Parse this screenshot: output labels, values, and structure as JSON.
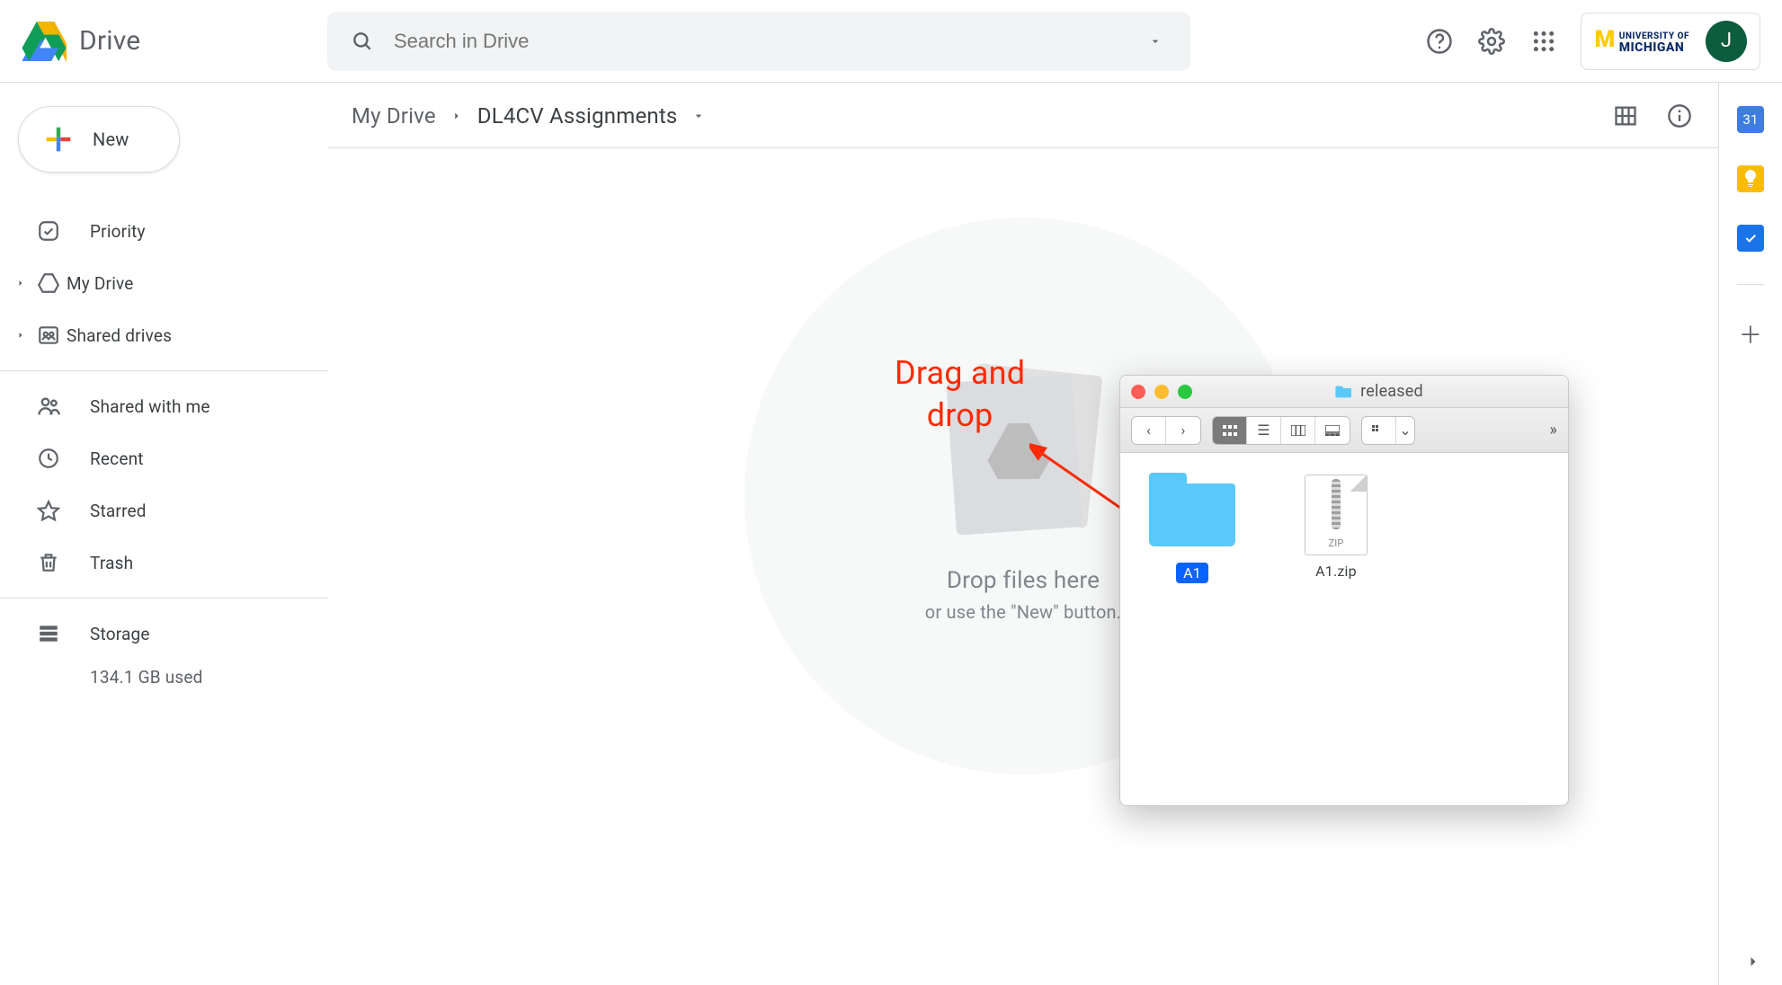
{
  "header": {
    "product_name": "Drive",
    "search_placeholder": "Search in Drive",
    "org_text_top": "UNIVERSITY OF",
    "org_text_bottom": "MICHIGAN",
    "avatar_initial": "J"
  },
  "sidebar": {
    "new_label": "New",
    "items": [
      {
        "label": "Priority",
        "icon": "priority-icon"
      },
      {
        "label": "My Drive",
        "icon": "my-drive-icon"
      },
      {
        "label": "Shared drives",
        "icon": "shared-drives-icon"
      },
      {
        "label": "Shared with me",
        "icon": "shared-with-me-icon"
      },
      {
        "label": "Recent",
        "icon": "recent-icon"
      },
      {
        "label": "Starred",
        "icon": "starred-icon"
      },
      {
        "label": "Trash",
        "icon": "trash-icon"
      }
    ],
    "storage_label": "Storage",
    "storage_used": "134.1 GB used"
  },
  "breadcrumbs": {
    "root": "My Drive",
    "current": "DL4CV Assignments"
  },
  "dropzone": {
    "line1": "Drop files here",
    "line2": "or use the \"New\" button."
  },
  "annotation": {
    "line1": "Drag and",
    "line2": "drop"
  },
  "finder": {
    "title": "released",
    "items": [
      {
        "name": "A1",
        "kind": "folder",
        "selected": true
      },
      {
        "name": "A1.zip",
        "kind": "zip",
        "selected": false
      }
    ],
    "zip_badge": "ZIP"
  },
  "rail": {
    "calendar_day": "31"
  }
}
